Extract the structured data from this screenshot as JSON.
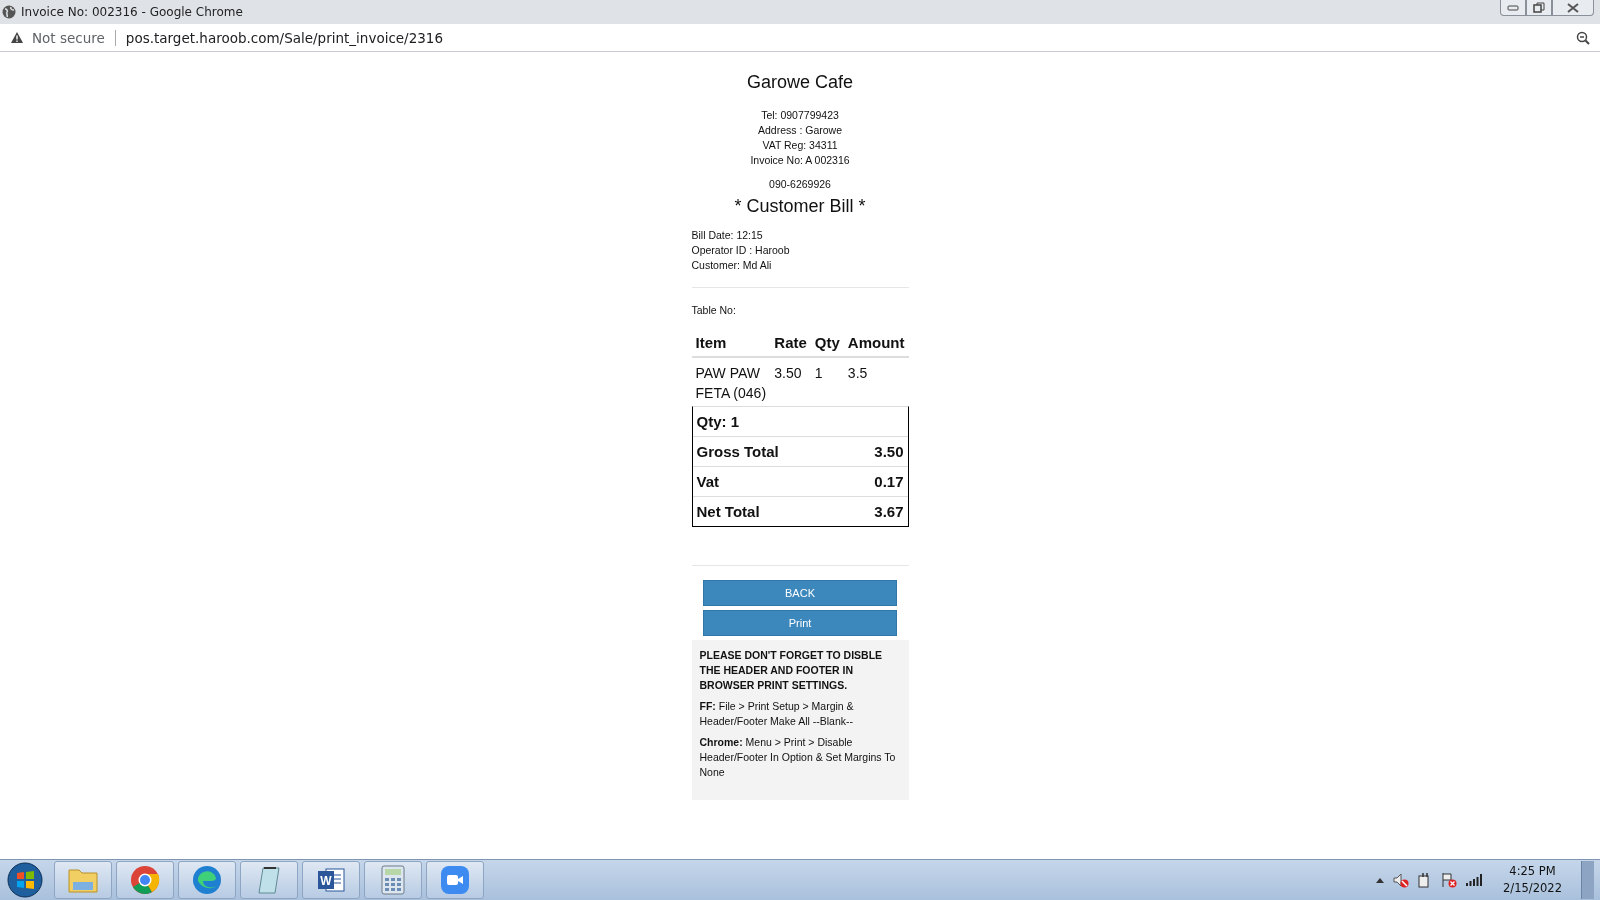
{
  "window": {
    "title": "Invoice No: 002316 - Google Chrome"
  },
  "address_bar": {
    "security": "Not secure",
    "url": "pos.target.haroob.com/Sale/print_invoice/2316"
  },
  "receipt": {
    "shop_name": "Garowe Cafe",
    "info_lines": [
      "Tel: 0907799423",
      "Address : Garowe",
      "VAT Reg: 34311",
      "Invoice No: A 002316"
    ],
    "phone": "090-6269926",
    "bill_title": "* Customer Bill *",
    "meta_lines": [
      "Bill Date: 12:15",
      "Operator ID : Haroob",
      "Customer: Md Ali"
    ],
    "table_no": "Table No:",
    "columns": [
      "Item",
      "Rate",
      "Qty",
      "Amount"
    ],
    "rows": [
      [
        "PAW PAW FETA (046)",
        "3.50",
        "1",
        "3.5"
      ]
    ],
    "quantity": "Qty: 1",
    "totals": [
      {
        "label": "Gross Total",
        "value": "3.50"
      },
      {
        "label": "Vat",
        "value": "0.17"
      },
      {
        "label": "Net Total",
        "value": "3.67"
      }
    ],
    "buttons": [
      "BACK",
      "Print"
    ],
    "notice": {
      "heading": "PLEASE DON'T FORGET TO DISBLE THE HEADER AND FOOTER IN BROWSER PRINT SETTINGS.",
      "paragraphs": [
        "**FF:** File > Print Setup > Margin & Header/Footer Make All --Blank--",
        "**Chrome:** Menu > Print > Disable Header/Footer In Option & Set Margins To None"
      ]
    }
  },
  "taskbar": {
    "apps": [
      {
        "kind": "folder"
      },
      {
        "kind": "chrome"
      },
      {
        "kind": "edge"
      },
      {
        "kind": "notepad"
      },
      {
        "kind": "word",
        "label": "W"
      },
      {
        "kind": "calculator"
      },
      {
        "kind": "video"
      }
    ],
    "time": "4:25 PM",
    "date": "2/15/2022"
  }
}
